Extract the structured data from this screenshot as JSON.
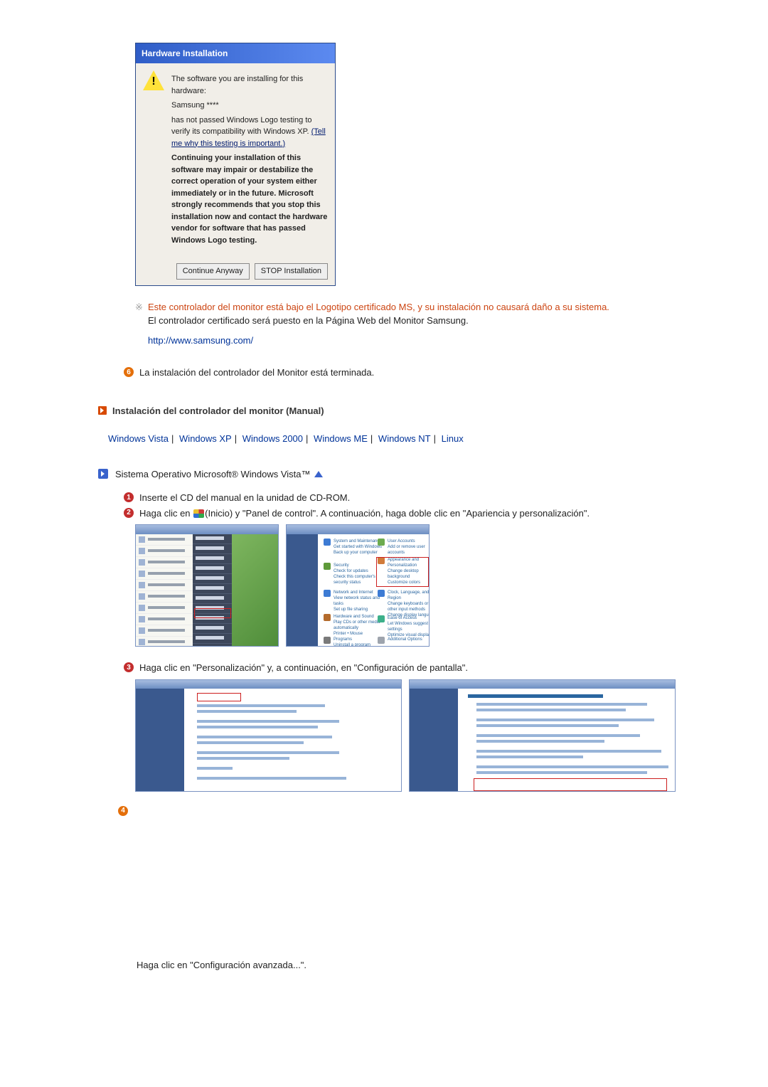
{
  "dialog": {
    "title": "Hardware Installation",
    "line1": "The software you are installing for this hardware:",
    "device": "Samsung ****",
    "line2a": "has not passed Windows Logo testing to verify its compatibility with Windows XP. ",
    "link": "(Tell me why this testing is important.)",
    "warn": "Continuing your installation of this software may impair or destabilize the correct operation of your system either immediately or in the future. Microsoft strongly recommends that you stop this installation now and contact the hardware vendor for software that has passed Windows Logo testing.",
    "btn_continue": "Continue Anyway",
    "btn_stop": "STOP Installation"
  },
  "note": {
    "line1": "Este controlador del monitor está bajo el Logotipo certificado MS, y su instalación no causará daño a su sistema.",
    "line2": "El controlador certificado será puesto en la Página Web del Monitor Samsung.",
    "url": "http://www.samsung.com/"
  },
  "step6": {
    "num": "6",
    "text": "La instalación del controlador del Monitor está terminada."
  },
  "section": {
    "title": "Instalación del controlador del monitor (Manual)"
  },
  "os": {
    "vista": "Windows Vista",
    "xp": "Windows XP",
    "w2000": "Windows 2000",
    "me": "Windows ME",
    "nt": "Windows NT",
    "linux": "Linux"
  },
  "sub": {
    "title": "Sistema Operativo Microsoft® Windows Vista™"
  },
  "s1": {
    "num": "1",
    "text": "Inserte el CD del manual en la unidad de CD-ROM."
  },
  "s2": {
    "num": "2",
    "pre": "Haga clic en ",
    "mid": "(Inicio) y \"Panel de control\". A continuación, haga doble clic en \"Apariencia y personalización\"."
  },
  "s3": {
    "num": "3",
    "text": "Haga clic en \"Personalización\" y, a continuación, en \"Configuración de pantalla\"."
  },
  "s4": {
    "num": "4"
  },
  "final": {
    "text": "Haga clic en \"Configuración avanzada...\"."
  }
}
